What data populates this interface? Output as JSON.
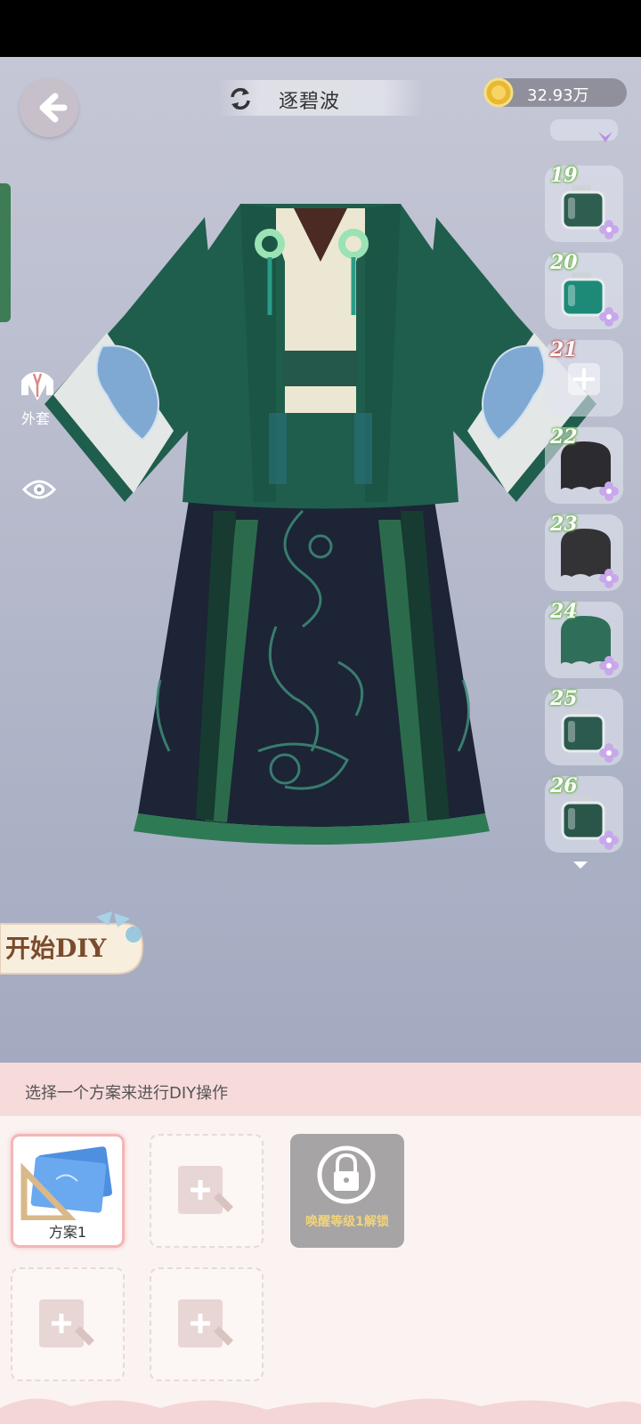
{
  "header": {
    "title": "逐碧波",
    "coins": "32.93万"
  },
  "left_panel": {
    "coat_label": "外套"
  },
  "slots": [
    {
      "number": "19",
      "kind": "dye-bottle",
      "color": "#2e5e50"
    },
    {
      "number": "20",
      "kind": "dye-bottle",
      "color": "#1d8a78"
    },
    {
      "number": "21",
      "kind": "empty-add",
      "color": ""
    },
    {
      "number": "22",
      "kind": "cloth",
      "color": "#2c2c30"
    },
    {
      "number": "23",
      "kind": "cloth",
      "color": "#333336"
    },
    {
      "number": "24",
      "kind": "cloth",
      "color": "#2f6e58"
    },
    {
      "number": "25",
      "kind": "dye-bottle",
      "color": "#2b5a4e"
    },
    {
      "number": "26",
      "kind": "dye-bottle",
      "color": "#2a564a"
    }
  ],
  "diy": {
    "start_label": "开始DIY"
  },
  "plans": {
    "instruction": "选择一个方案来进行DIY操作",
    "cards": [
      {
        "label": "方案1",
        "state": "selected"
      },
      {
        "label": "",
        "state": "empty"
      },
      {
        "label": "唤醒等级1解锁",
        "state": "locked"
      },
      {
        "label": "",
        "state": "empty"
      },
      {
        "label": "",
        "state": "empty"
      }
    ]
  },
  "colors": {
    "robe_green": "#1f5e4c",
    "skirt_navy": "#1c2436",
    "accent_pink": "#f2b7b7"
  }
}
